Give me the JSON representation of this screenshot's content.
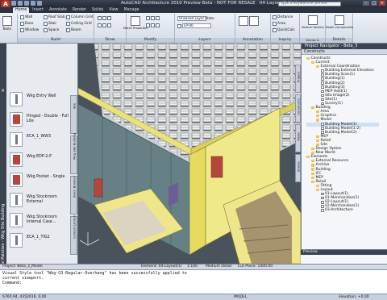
{
  "app": {
    "title": "AutoCAD Architecture 2010 Preview Beta - NOT FOR RESALE",
    "document": "04-Layout(2 1).dwg",
    "search_placeholder": "Type a keyword or phrase",
    "logo": "A"
  },
  "tabs": [
    "Home",
    "Insert",
    "Annotate",
    "Render",
    "Solids",
    "View",
    "Manage"
  ],
  "ribbon": {
    "panels": [
      {
        "title": "Build",
        "items": [
          "Wall",
          "Door",
          "Window",
          "Roof Slab",
          "Stair",
          "Space",
          "Column Grid",
          "Ceiling Grid",
          "Beam"
        ]
      },
      {
        "title": "Draw"
      },
      {
        "title": "Modify"
      },
      {
        "title": "Layers",
        "items": [
          "Unsaved Layer State",
          "LP-00"
        ]
      },
      {
        "title": "Annotation"
      },
      {
        "title": "Inquiry",
        "items": [
          "Distance",
          "Area",
          "QuickCalc"
        ]
      },
      {
        "title": "Section & Elevation",
        "items": [
          "Vertical Section"
        ]
      },
      {
        "title": "Details",
        "items": [
          "Detail Components"
        ]
      }
    ],
    "side_labels": [
      "Tools",
      "Match Properties"
    ]
  },
  "tool_palette": {
    "title": "Tool Palettes - Wkg Site Building",
    "tools": [
      "Wkg Entry Wall",
      "Hinged - Double - Full Lite",
      "ECA_1_WW3",
      "Wkg EDP-2-P",
      "Wkg Pocket - Single",
      "Wkg Stockroom External",
      "Wkg Stockroom Internal Case...",
      "ECA_1_TIG2"
    ],
    "side_tabs": [
      "Content Library",
      "Stock Browser",
      "Wkg Site Building",
      "Site"
    ]
  },
  "navigator": {
    "title": "Project Navigator - Beta_3",
    "section": "Constructs",
    "tree": [
      {
        "label": "Constructs",
        "level": 0,
        "type": "folder"
      },
      {
        "label": "Current",
        "level": 1,
        "type": "folder"
      },
      {
        "label": "External Coordination",
        "level": 2,
        "type": "folder"
      },
      {
        "label": "Building External Elevation",
        "level": 3,
        "type": "file"
      },
      {
        "label": "Building Scan(1)",
        "level": 3,
        "type": "file"
      },
      {
        "label": "Building(1)",
        "level": 3,
        "type": "file"
      },
      {
        "label": "Building(2)",
        "level": 3,
        "type": "file"
      },
      {
        "label": "Building(3)",
        "level": 3,
        "type": "file"
      },
      {
        "label": "MEP Hold(1)",
        "level": 3,
        "type": "file"
      },
      {
        "label": "Site Image(2)",
        "level": 3,
        "type": "file"
      },
      {
        "label": "Site(1)",
        "level": 3,
        "type": "file"
      },
      {
        "label": "Survey(1)",
        "level": 3,
        "type": "file"
      },
      {
        "label": "Building",
        "level": 1,
        "type": "folder"
      },
      {
        "label": "Area",
        "level": 2,
        "type": "folder"
      },
      {
        "label": "Graphics",
        "level": 2,
        "type": "folder"
      },
      {
        "label": "Model",
        "level": 2,
        "type": "folder"
      },
      {
        "label": "Building Model(1)",
        "level": 3,
        "type": "file",
        "selected": true
      },
      {
        "label": "Building Model(1-2)",
        "level": 3,
        "type": "file"
      },
      {
        "label": "Building Model(2)",
        "level": 3,
        "type": "file"
      },
      {
        "label": "MEP",
        "level": 2,
        "type": "folder"
      },
      {
        "label": "Retail",
        "level": 2,
        "type": "folder"
      },
      {
        "label": "Site",
        "level": 2,
        "type": "folder"
      },
      {
        "label": "Design Option",
        "level": 1,
        "type": "folder"
      },
      {
        "label": "New World",
        "level": 1,
        "type": "folder"
      },
      {
        "label": "Elements",
        "level": 0,
        "type": "folder"
      },
      {
        "label": "External Resource",
        "level": 1,
        "type": "folder"
      },
      {
        "label": "Archive",
        "level": 1,
        "type": "folder"
      },
      {
        "label": "Building",
        "level": 1,
        "type": "folder"
      },
      {
        "label": "IFC",
        "level": 1,
        "type": "folder"
      },
      {
        "label": "MEP",
        "level": 1,
        "type": "folder"
      },
      {
        "label": "Retail",
        "level": 1,
        "type": "folder"
      },
      {
        "label": "Fitting",
        "level": 2,
        "type": "folder"
      },
      {
        "label": "Layout",
        "level": 2,
        "type": "folder"
      },
      {
        "label": "01-Layout(1)",
        "level": 3,
        "type": "file"
      },
      {
        "label": "01-Merchandise(1)",
        "level": 3,
        "type": "file"
      },
      {
        "label": "02-Layout(1)",
        "level": 3,
        "type": "file"
      },
      {
        "label": "02-Merchandise(1)",
        "level": 3,
        "type": "file"
      },
      {
        "label": "03-Architecture",
        "level": 3,
        "type": "file"
      }
    ],
    "side_tabs": [
      "Project",
      "Constructs",
      "Views",
      "Sheets"
    ],
    "preview_title": "Preview"
  },
  "status": {
    "project": "Project: Beta_3_Model",
    "element": "Element: 04-Layout(1)",
    "scale": "1:100",
    "detail": "Medium Detail",
    "cut_plane": "Cut Plane: 1400.00"
  },
  "command": {
    "lines": [
      "Visual Style tool \"Wkg-CO-Regular-Overhang\" has been successfully applied to",
      "current viewport.",
      "",
      "Command:"
    ]
  },
  "bottombar": {
    "coords": "6760.94, 4352016, 0.00",
    "model": "MODEL",
    "elevation": "Elevation: +0.00"
  }
}
